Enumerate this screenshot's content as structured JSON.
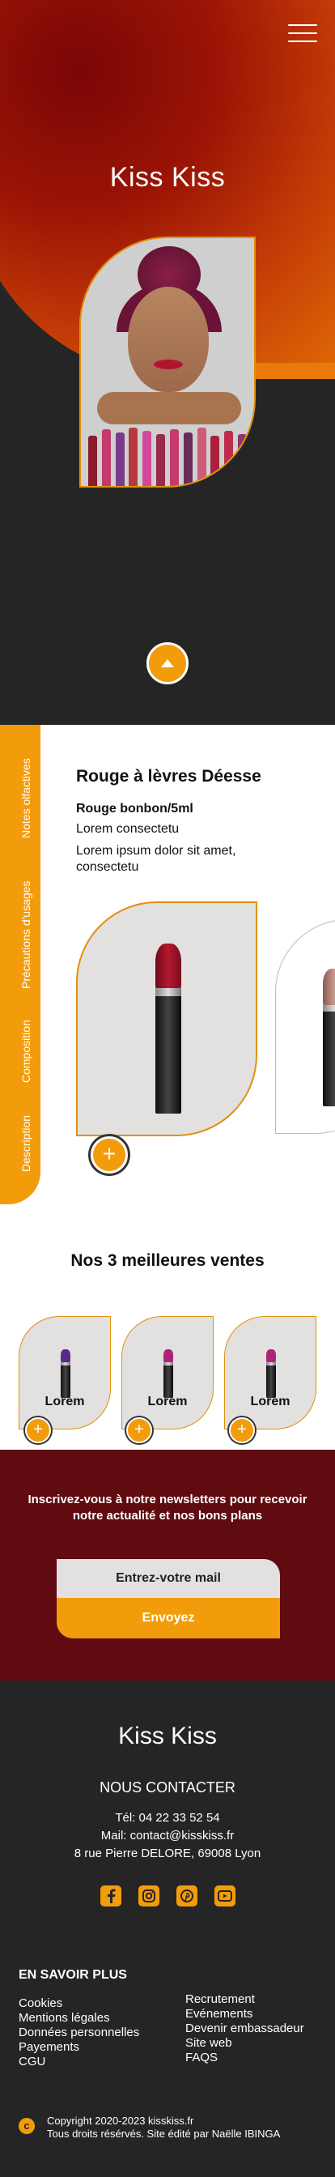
{
  "hero": {
    "title": "Kiss Kiss"
  },
  "product": {
    "tabs": [
      "Notes olfactives",
      "Précautions d'usages",
      "Composition",
      "Description"
    ],
    "title": "Rouge à lèvres Déesse",
    "subtitle": "Rouge bonbon/5ml",
    "line1": "Lorem consectetu",
    "line2": "Lorem ipsum dolor sit amet, consectetu"
  },
  "best": {
    "title": "Nos 3 meilleures ventes",
    "items": [
      {
        "label": "Lorem",
        "color": "#5a2a8a"
      },
      {
        "label": "Lorem",
        "color": "#b0227a"
      },
      {
        "label": "Lorem",
        "color": "#b0227a"
      }
    ]
  },
  "newsletter": {
    "text": "Inscrivez-vous à notre newsletters pour recevoir notre actualité et nos bons plans",
    "placeholder": "Entrez-votre mail",
    "button": "Envoyez"
  },
  "footer": {
    "brand": "Kiss Kiss",
    "contact_title": "NOUS CONTACTER",
    "phone": "Tél: 04 22 33 52 54",
    "mail": "Mail: contact@kisskiss.fr",
    "address": "8 rue Pierre DELORE, 69008 Lyon",
    "socials": [
      "facebook-icon",
      "instagram-icon",
      "pinterest-icon",
      "youtube-icon"
    ],
    "more_title": "EN SAVOIR PLUS",
    "left_links": [
      "Cookies",
      "Mentions légales",
      "Données personnelles",
      "Payements",
      "CGU"
    ],
    "right_links": [
      "Recrutement",
      "Evénements",
      "Devenir embassadeur",
      "Site web",
      "FAQS"
    ],
    "copyright_symbol": "c",
    "copyright1": "Copyright 2020-2023 kisskiss.fr",
    "copyright2": "Tous droits résérvés. Site édité par Naëlle IBINGA"
  },
  "colors": {
    "accent": "#f39c0b",
    "dark": "#252525",
    "burgundy": "#5f0b0f"
  }
}
